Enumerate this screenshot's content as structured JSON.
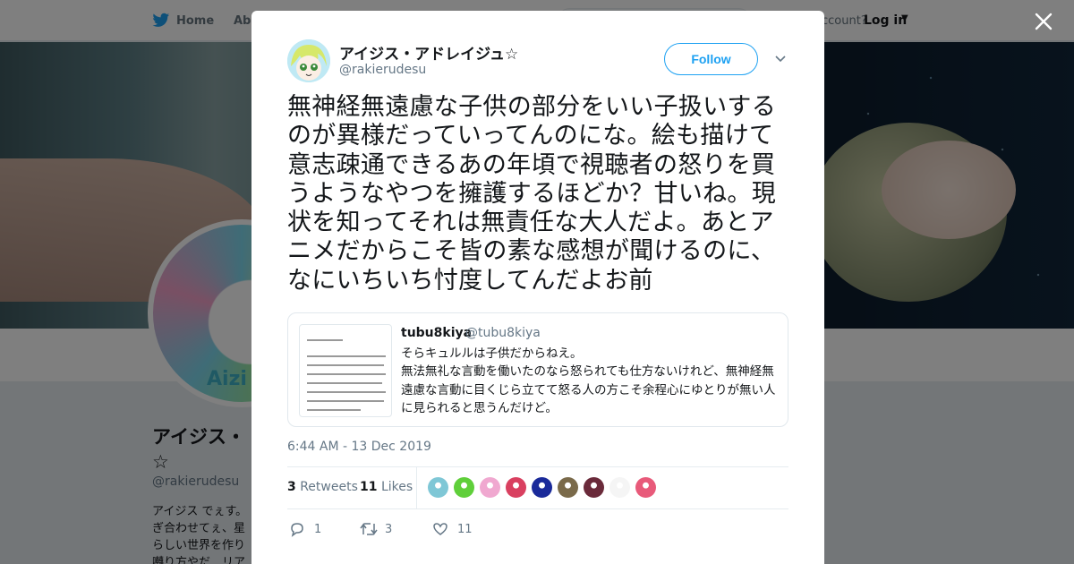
{
  "background": {
    "nav": {
      "home_label": "Home",
      "about_label": "Abo",
      "account_prompt": "ccount?",
      "login_label": "Log in"
    },
    "profile": {
      "name": "アイジス・☆",
      "handle": "@rakierudesu",
      "bio": "アイジス でぇす。ぎ合わせてぇ、星らしい世界を作り囀り方やだ…リア",
      "avatar_text": "Aizi"
    }
  },
  "tweet": {
    "author_name": "アイジス・アドレイジュ☆",
    "author_handle": "@rakierudesu",
    "follow_label": "Follow",
    "text": "無神経無遠慮な子供の部分をいい子扱いするのが異様だっていってんのにな。絵も描けて意志疎通できるあの年頃で視聴者の怒りを買うようなやつを擁護するほどか？甘いね。現状を知ってそれは無責任な大人だよ。あとアニメだからこそ皆の素な感想が聞けるのに、なにいちいち忖度してんだよお前",
    "timestamp": "6:44 AM - 13 Dec 2019",
    "quote": {
      "author_name": "tubu8kiya",
      "author_handle": "@tubu8kiya",
      "text": "そらキュルルは子供だからねえ。\n無法無礼な言動を働いたのなら怒られても仕方ないけれど、無神経無遠慮な言動に目くじら立てて怒る人の方こそ余程心にゆとりが無い人に見られると思うんだけど。"
    },
    "stats": {
      "retweets_count": "3",
      "retweets_label": "Retweets",
      "likes_count": "11",
      "likes_label": "Likes"
    },
    "actions": {
      "reply_count": "1",
      "retweet_count": "3",
      "like_count": "11"
    }
  },
  "colors": {
    "accent": "#1da1f2",
    "text_primary": "#14171a",
    "text_secondary": "#657786",
    "likers": [
      "#7fc7d6",
      "#5fcf3a",
      "#f0a8d0",
      "#d94060",
      "#1a2a9a",
      "#7a6a4a",
      "#6a2a3a",
      "#f5f5f5",
      "#e85a7a"
    ]
  },
  "icons": {
    "close": "close-icon",
    "caret": "chevron-down-icon",
    "reply": "reply-icon",
    "retweet": "retweet-icon",
    "like": "heart-icon",
    "bird": "bird-icon"
  }
}
